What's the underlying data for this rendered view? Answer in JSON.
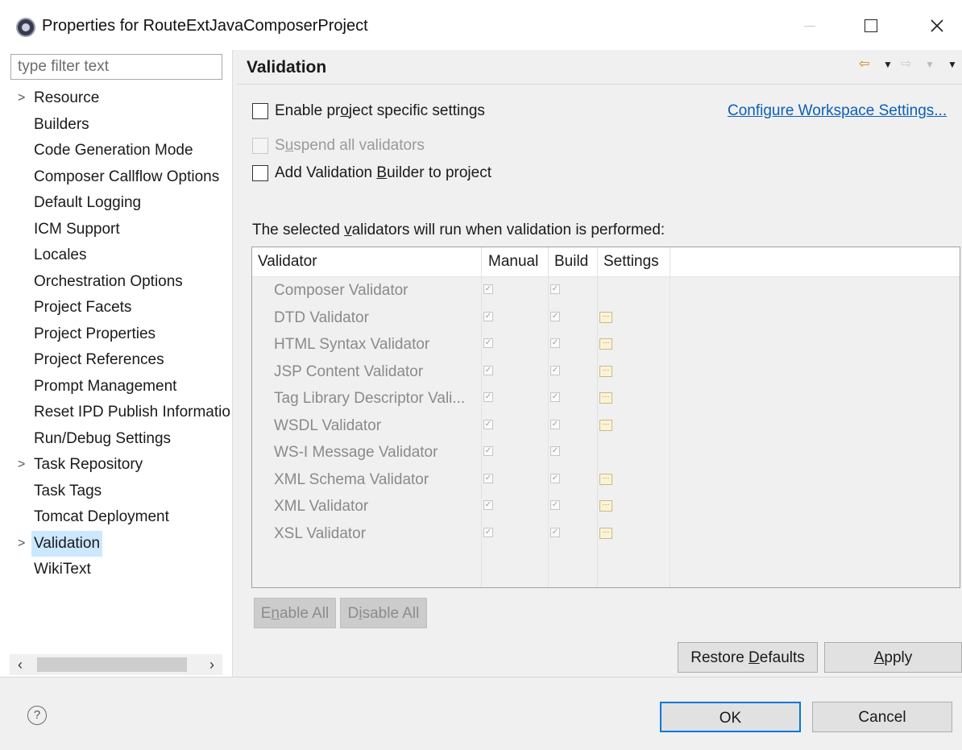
{
  "window": {
    "title": "Properties for RouteExtJavaComposerProject"
  },
  "filter": {
    "placeholder": "type filter text"
  },
  "tree": {
    "items": [
      {
        "label": "Resource",
        "expandable": true
      },
      {
        "label": "Builders"
      },
      {
        "label": "Code Generation Mode"
      },
      {
        "label": "Composer Callflow Options"
      },
      {
        "label": "Default Logging"
      },
      {
        "label": "ICM Support"
      },
      {
        "label": "Locales"
      },
      {
        "label": "Orchestration Options"
      },
      {
        "label": "Project Facets"
      },
      {
        "label": "Project Properties"
      },
      {
        "label": "Project References"
      },
      {
        "label": "Prompt Management"
      },
      {
        "label": "Reset IPD Publish Information"
      },
      {
        "label": "Run/Debug Settings"
      },
      {
        "label": "Task Repository",
        "expandable": true
      },
      {
        "label": "Task Tags"
      },
      {
        "label": "Tomcat Deployment"
      },
      {
        "label": "Validation",
        "expandable": true,
        "selected": true
      },
      {
        "label": "WikiText"
      }
    ],
    "selection_color": "#cce8ff"
  },
  "page": {
    "title": "Validation",
    "enable_project_settings": {
      "pre": "Enable pr",
      "u": "o",
      "post": "ject specific settings"
    },
    "configure_link": "Configure Workspace Settings...",
    "suspend_validators": {
      "pre": "S",
      "u": "u",
      "post": "spend all validators"
    },
    "add_builder": {
      "pre": "Add Validation ",
      "u": "B",
      "post": "uilder to project"
    },
    "table_caption": {
      "pre": "The selected ",
      "u": "v",
      "post": "alidators will run when validation is performed:"
    }
  },
  "table": {
    "headers": {
      "validator": "Validator",
      "manual": "Manual",
      "build": "Build",
      "settings": "Settings"
    },
    "rows": [
      {
        "name": "Composer Validator",
        "manual": true,
        "build": true,
        "settings": false
      },
      {
        "name": "DTD Validator",
        "manual": true,
        "build": true,
        "settings": true
      },
      {
        "name": "HTML Syntax Validator",
        "manual": true,
        "build": true,
        "settings": true
      },
      {
        "name": "JSP Content Validator",
        "manual": true,
        "build": true,
        "settings": true
      },
      {
        "name": "Tag Library Descriptor Vali...",
        "manual": true,
        "build": true,
        "settings": true
      },
      {
        "name": "WSDL Validator",
        "manual": true,
        "build": true,
        "settings": true
      },
      {
        "name": "WS-I Message Validator",
        "manual": true,
        "build": true,
        "settings": false
      },
      {
        "name": "XML Schema Validator",
        "manual": true,
        "build": true,
        "settings": true
      },
      {
        "name": "XML Validator",
        "manual": true,
        "build": true,
        "settings": true
      },
      {
        "name": "XSL Validator",
        "manual": true,
        "build": true,
        "settings": true
      }
    ]
  },
  "buttons": {
    "enable_all": {
      "pre": "E",
      "u": "n",
      "post": "able All"
    },
    "disable_all": {
      "pre": "D",
      "u": "i",
      "post": "sable All"
    },
    "restore_defaults": {
      "pre": "Restore ",
      "u": "D",
      "post": "efaults"
    },
    "apply": {
      "pre": "",
      "u": "A",
      "post": "pply"
    },
    "ok": "OK",
    "cancel": "Cancel"
  },
  "colors": {
    "link": "#0b5fb8",
    "primary_border": "#0078d7"
  }
}
